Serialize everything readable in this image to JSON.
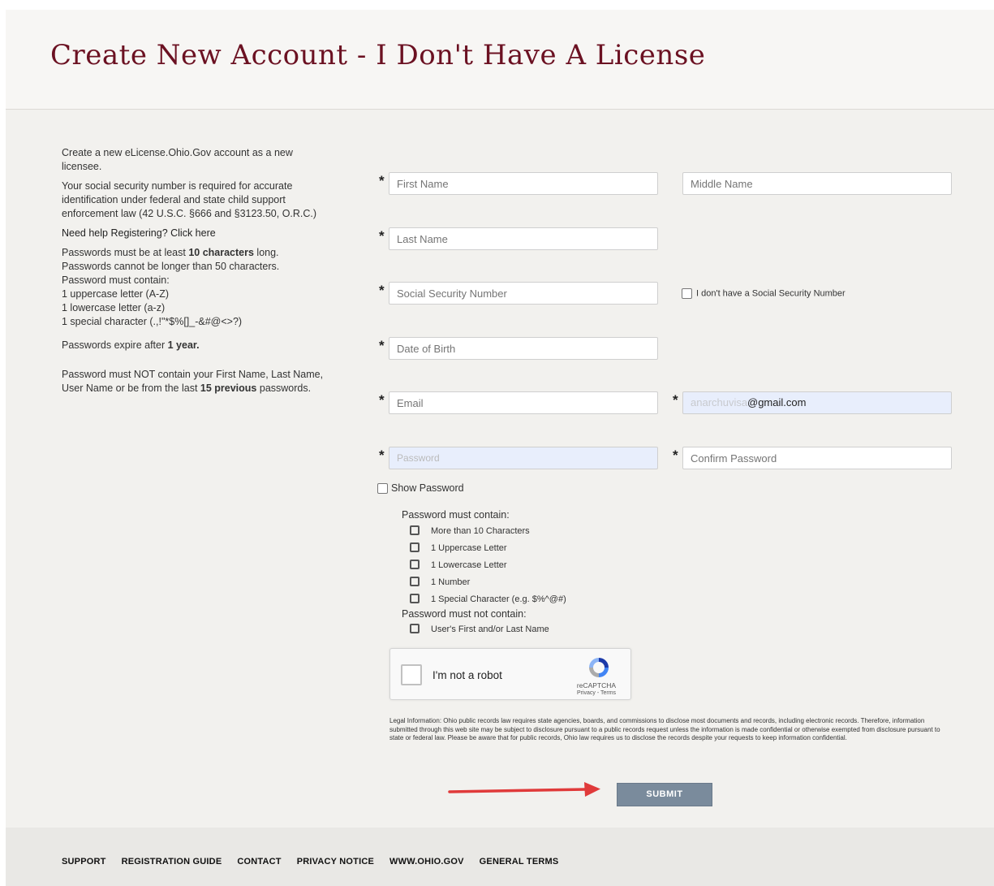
{
  "page": {
    "title": "Create New Account - I Don't Have A License"
  },
  "info": {
    "intro": "Create a new eLicense.Ohio.Gov account as a new licensee.",
    "ssn_note": "Your social security number is required for accurate identification under federal and state child support enforcement law (42 U.S.C. §666 and §3123.50, O.R.C.)",
    "help_link": "Need help Registering? Click here",
    "pw_length_pre": "Passwords must be at least ",
    "pw_length_bold": "10 characters",
    "pw_length_post": " long.",
    "pw_max": "Passwords cannot be longer than 50 characters.",
    "pw_contain": "Password must contain:",
    "pw_upper": "1 uppercase letter (A-Z)",
    "pw_lower": "1 lowercase letter (a-z)",
    "pw_special": "1 special character (.,!\"*$%[]_-&#@<>?)",
    "pw_expire_pre": "Passwords expire after ",
    "pw_expire_bold": "1 year.",
    "pw_not_pre": "Password must NOT contain your First Name, Last Name, User Name or be from the last ",
    "pw_not_bold": "15 previous",
    "pw_not_post": " passwords."
  },
  "form": {
    "first_name_placeholder": "First Name",
    "middle_name_placeholder": "Middle Name",
    "last_name_placeholder": "Last Name",
    "ssn_placeholder": "Social Security Number",
    "no_ssn_label": "I don't have a Social Security Number",
    "dob_placeholder": "Date of Birth",
    "email_placeholder": "Email",
    "confirm_email_value": "@gmail.com",
    "confirm_email_ghost": "anarchuvisa",
    "password_value": "Password",
    "confirm_password_placeholder": "Confirm Password",
    "show_password_label": "Show Password",
    "required_mark": "*"
  },
  "rules": {
    "must_contain_heading": "Password must contain:",
    "must_contain": [
      "More than 10 Characters",
      "1 Uppercase Letter",
      "1 Lowercase Letter",
      "1 Number",
      "1 Special Character (e.g. $%^@#)"
    ],
    "must_not_heading": "Password must not contain:",
    "must_not": [
      "User's First and/or Last Name"
    ]
  },
  "captcha": {
    "label": "I'm not a robot",
    "brand": "reCAPTCHA",
    "terms": "Privacy - Terms"
  },
  "legal": "Legal Information: Ohio public records law requires state agencies, boards, and commissions to disclose most documents and records, including electronic records. Therefore, information submitted through this web site may be subject to disclosure pursuant to a public records request unless the information is made confidential or otherwise exempted from disclosure pursuant to state or federal law. Please be aware that for public records, Ohio law requires us to disclose the records despite your requests to keep information confidential.",
  "submit_label": "SUBMIT",
  "colors": {
    "title": "#6b1122",
    "submit_bg": "#7a8b9c",
    "arrow": "#e03a3a",
    "autofill_bg": "#e8eefc"
  },
  "footer": {
    "links": [
      "SUPPORT",
      "REGISTRATION GUIDE",
      "CONTACT",
      "PRIVACY NOTICE",
      "WWW.OHIO.GOV",
      "GENERAL TERMS"
    ]
  }
}
